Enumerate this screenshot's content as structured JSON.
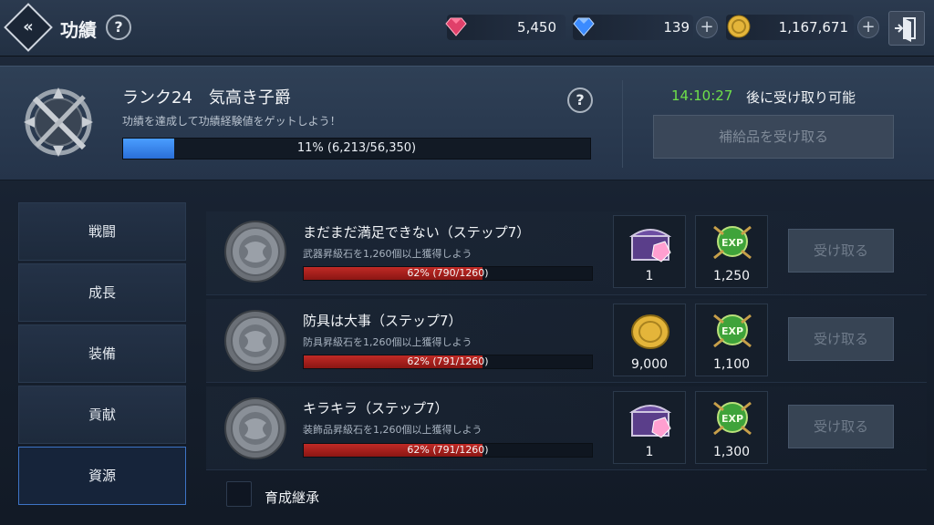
{
  "header": {
    "title": "功績",
    "help_label": "?",
    "currencies": [
      {
        "icon": "red-gem-icon",
        "value": "5,450",
        "color": "#e0406a"
      },
      {
        "icon": "blue-gem-icon",
        "value": "139",
        "color": "#3b8bff"
      },
      {
        "icon": "gold-coin-icon",
        "value": "1,167,671",
        "color": "#e4b53a"
      }
    ],
    "plus_label": "+"
  },
  "rank": {
    "title": "ランク24　気高き子爵",
    "subtitle": "功績を達成して功績経験値をゲットしよう！",
    "progress_text": "11% (6,213/56,350)",
    "progress_fraction": 0.11,
    "help_label": "?",
    "timer": "14:10:27",
    "timer_suffix": "後に受け取り可能",
    "supply_button": "補給品を受け取る"
  },
  "sidebar": {
    "items": [
      {
        "label": "戦闘",
        "active": false
      },
      {
        "label": "成長",
        "active": false
      },
      {
        "label": "装備",
        "active": false
      },
      {
        "label": "貢献",
        "active": false
      },
      {
        "label": "資源",
        "active": true
      }
    ]
  },
  "quests": [
    {
      "title": "まだまだ満足できない（ステップ7）",
      "desc": "武器昇級石を1,260個以上獲得しよう",
      "progress_text": "62% (790/1260)",
      "progress_fraction": 0.62,
      "rewards": [
        {
          "icon": "treasure-chest-icon",
          "amount": "1"
        },
        {
          "icon": "exp-icon",
          "amount": "1,250",
          "label": "EXP"
        }
      ],
      "claim_label": "受け取る"
    },
    {
      "title": "防具は大事（ステップ7）",
      "desc": "防具昇級石を1,260個以上獲得しよう",
      "progress_text": "62% (791/1260)",
      "progress_fraction": 0.62,
      "rewards": [
        {
          "icon": "gold-coin-icon",
          "amount": "9,000"
        },
        {
          "icon": "exp-icon",
          "amount": "1,100",
          "label": "EXP"
        }
      ],
      "claim_label": "受け取る"
    },
    {
      "title": "キラキラ（ステップ7）",
      "desc": "装飾品昇級石を1,260個以上獲得しよう",
      "progress_text": "62% (791/1260)",
      "progress_fraction": 0.62,
      "rewards": [
        {
          "icon": "treasure-chest-icon",
          "amount": "1"
        },
        {
          "icon": "exp-icon",
          "amount": "1,300",
          "label": "EXP"
        }
      ],
      "claim_label": "受け取る"
    }
  ],
  "inherit": {
    "label": "育成継承",
    "checked": false
  }
}
